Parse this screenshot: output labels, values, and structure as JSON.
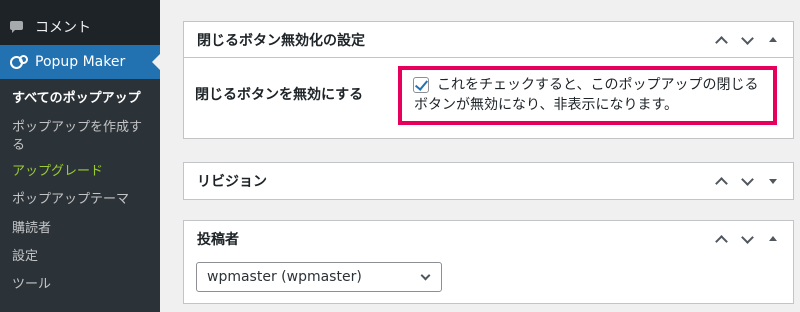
{
  "sidebar": {
    "comments_label": "コメント",
    "active_menu_label": "Popup Maker",
    "submenu": [
      {
        "label": "すべてのポップアップ"
      },
      {
        "label": "ポップアップを作成す"
      },
      {
        "label": "る"
      },
      {
        "label": "アップグレード"
      },
      {
        "label": "ポップアップテーマ"
      },
      {
        "label": "購読者"
      },
      {
        "label": "設定"
      },
      {
        "label": "ツール"
      }
    ]
  },
  "colors": {
    "sidebar_bg": "#1d2327",
    "active_menu": "#2271b1",
    "upgrade_text": "#9acd32",
    "highlight_border": "#e6005c"
  },
  "panels": {
    "close_button": {
      "title": "閉じるボタン無効化の設定",
      "setting_label": "閉じるボタンを無効にする",
      "checkbox_checked": true,
      "checkbox_text": "これをチェックすると、このポップアップの閉じるボタンが無効になり、非表示になります。"
    },
    "revision": {
      "title": "リビジョン"
    },
    "author": {
      "title": "投稿者",
      "selected_author": "wpmaster (wpmaster)"
    }
  },
  "icons": [
    "comment-icon",
    "popup-maker-icon",
    "chevron-up-icon",
    "chevron-down-icon",
    "triangle-up-icon",
    "triangle-down-icon",
    "checkbox-check-icon",
    "select-caret-icon"
  ]
}
